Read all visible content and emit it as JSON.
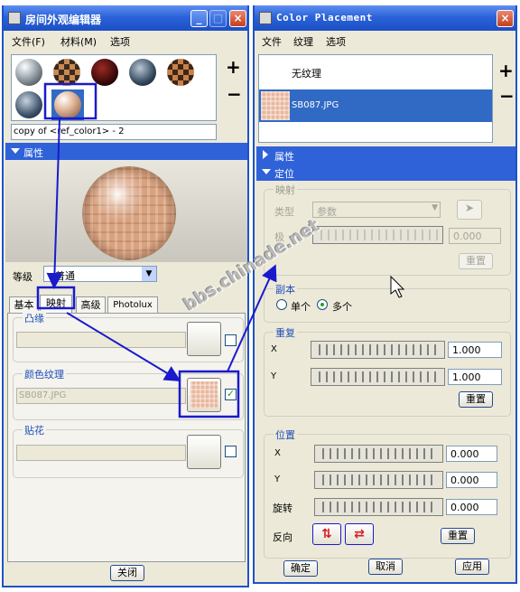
{
  "left_window": {
    "title": "房间外观编辑器",
    "menu": [
      "文件(F)",
      "材料(M)",
      "选项"
    ],
    "material_name": "copy of <ref_color1> - 2",
    "properties_header": "属性",
    "level_label": "等级",
    "level_value": "普通",
    "tabs": [
      "基本",
      "映射",
      "高级",
      "Photolux"
    ],
    "bump_label": "凸缘",
    "color_texture_label": "颜色纹理",
    "color_texture_value": "SB087.JPG",
    "decal_label": "贴花",
    "close_button": "关闭",
    "plus": "+",
    "minus": "−"
  },
  "right_window": {
    "title": "Color Placement",
    "menu": [
      "文件",
      "纹理",
      "选项"
    ],
    "texture_list": [
      "无纹理",
      "SB087.JPG"
    ],
    "properties_header": "属性",
    "placement_header": "定位",
    "mapping": {
      "title": "映射",
      "type_label": "类型",
      "type_value": "参数",
      "pole_label": "极",
      "pole_value": "0.000",
      "reset": "重置"
    },
    "copies": {
      "title": "副本",
      "single": "单个",
      "multiple": "多个"
    },
    "repeat": {
      "title": "重复",
      "x_label": "X",
      "x_value": "1.000",
      "y_label": "Y",
      "y_value": "1.000",
      "reset": "重置"
    },
    "position": {
      "title": "位置",
      "x_label": "X",
      "x_value": "0.000",
      "y_label": "Y",
      "y_value": "0.000",
      "rotate_label": "旋转",
      "rotate_value": "0.000",
      "reverse_label": "反向",
      "reset": "重置"
    },
    "ok": "确定",
    "cancel": "取消",
    "apply": "应用",
    "plus": "+",
    "minus": "−"
  },
  "title_buttons": {
    "minimize": "_",
    "maximize": "□",
    "close": "×"
  },
  "watermark": "bbs.chinade.net",
  "colors": {
    "title_blue": "#2b63d9",
    "selection_blue": "#316ac5",
    "annotation_blue": "#1a1acc"
  }
}
